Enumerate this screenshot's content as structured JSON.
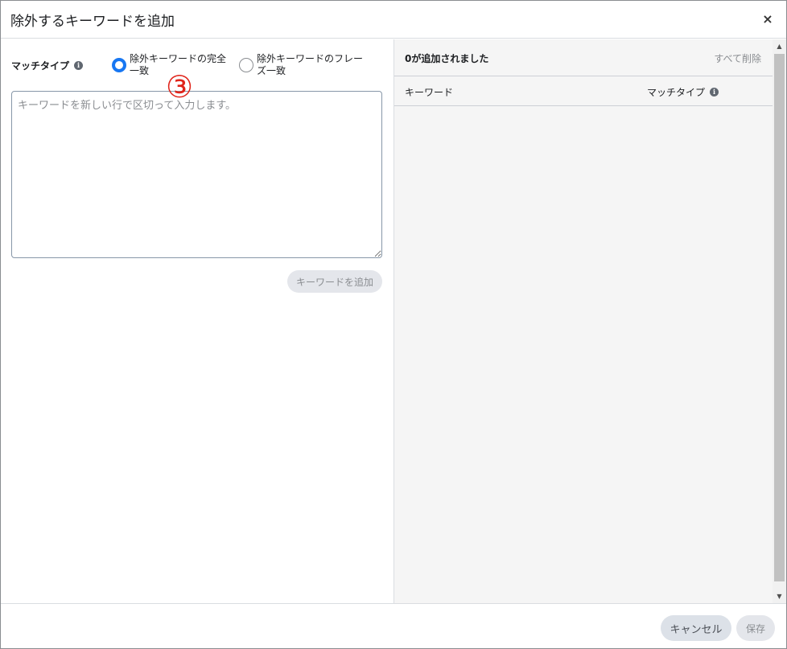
{
  "dialog": {
    "title": "除外するキーワードを追加",
    "close_symbol": "×"
  },
  "left": {
    "match_type_label": "マッチタイプ",
    "info_symbol": "i",
    "options": [
      {
        "label": "除外キーワードの完全一致",
        "selected": true
      },
      {
        "label": "除外キーワードのフレーズ一致",
        "selected": false
      }
    ],
    "annotation": "③",
    "keywords_placeholder": "キーワードを新しい行で区切って入力します。",
    "add_button": "キーワードを追加"
  },
  "right": {
    "added_count": "0が追加されました",
    "delete_all": "すべて削除",
    "columns": {
      "keyword": "キーワード",
      "match_type": "マッチタイプ"
    }
  },
  "scrollbar": {
    "up_arrow": "▲",
    "down_arrow": "▼"
  },
  "footer": {
    "cancel": "キャンセル",
    "save": "保存"
  },
  "colors": {
    "accent": "#1877f2",
    "annotation": "#e0241a",
    "panel_bg": "#f5f5f5"
  }
}
